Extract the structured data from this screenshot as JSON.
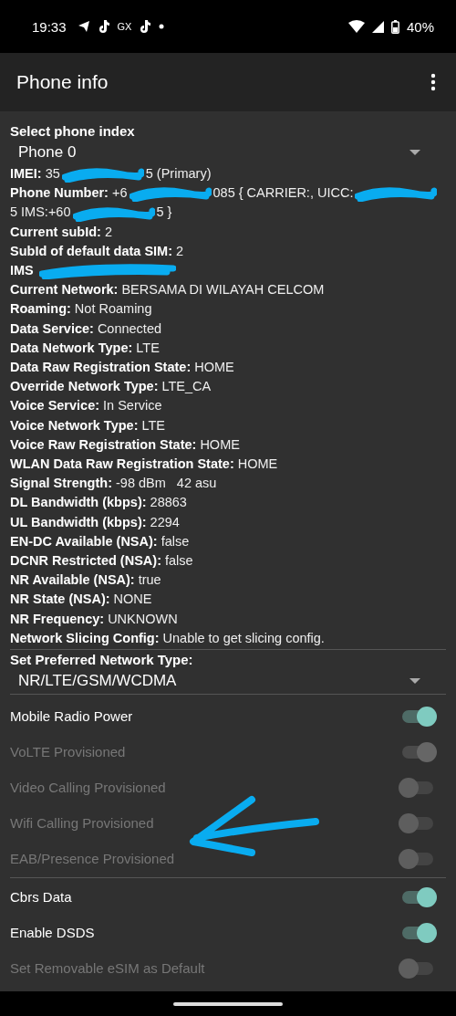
{
  "status_bar": {
    "time": "19:33",
    "notification_text": "GX",
    "battery": "40%"
  },
  "app_bar": {
    "title": "Phone info"
  },
  "phone_index": {
    "label": "Select phone index",
    "value": "Phone 0"
  },
  "info_rows": [
    {
      "label": "IMEI:",
      "parts": [
        "35",
        "5 (Primary)"
      ]
    },
    {
      "label": "Phone Number:",
      "parts": [
        "+6",
        "085 { CARRIER:, UICC:",
        "5 IMS:+60",
        "5 }"
      ]
    },
    {
      "label": "Current subId:",
      "value": "2"
    },
    {
      "label": "SubId of default data SIM:",
      "value": "2"
    },
    {
      "label": "IMS",
      "redacted": true
    },
    {
      "label": "Current Network:",
      "value": "BERSAMA DI WILAYAH CELCOM"
    },
    {
      "label": "Roaming:",
      "value": "Not Roaming"
    },
    {
      "label": "Data Service:",
      "value": "Connected"
    },
    {
      "label": "Data Network Type:",
      "value": "LTE"
    },
    {
      "label": "Data Raw Registration State:",
      "value": "HOME"
    },
    {
      "label": "Override Network Type:",
      "value": "LTE_CA"
    },
    {
      "label": "Voice Service:",
      "value": "In Service"
    },
    {
      "label": "Voice Network Type:",
      "value": "LTE"
    },
    {
      "label": "Voice Raw Registration State:",
      "value": "HOME"
    },
    {
      "label": "WLAN Data Raw Registration State:",
      "value": "HOME"
    },
    {
      "label": "Signal Strength:",
      "value": "-98 dBm   42 asu"
    },
    {
      "label": "DL Bandwidth (kbps):",
      "value": "28863"
    },
    {
      "label": "UL Bandwidth (kbps):",
      "value": "2294"
    },
    {
      "label": "EN-DC Available (NSA):",
      "value": "false"
    },
    {
      "label": "DCNR Restricted (NSA):",
      "value": "false"
    },
    {
      "label": "NR Available (NSA):",
      "value": "true"
    },
    {
      "label": "NR State (NSA):",
      "value": "NONE"
    },
    {
      "label": "NR Frequency:",
      "value": "UNKNOWN"
    },
    {
      "label": "Network Slicing Config:",
      "value": "Unable to get slicing config."
    }
  ],
  "network_type": {
    "label": "Set Preferred Network Type:",
    "value": "NR/LTE/GSM/WCDMA"
  },
  "toggle_groups": [
    [
      {
        "label": "Mobile Radio Power",
        "on": true,
        "disabled": false
      },
      {
        "label": "VoLTE Provisioned",
        "on": true,
        "disabled": true
      },
      {
        "label": "Video Calling Provisioned",
        "on": false,
        "disabled": true
      },
      {
        "label": "Wifi Calling Provisioned",
        "on": false,
        "disabled": true
      },
      {
        "label": "EAB/Presence Provisioned",
        "on": false,
        "disabled": true
      }
    ],
    [
      {
        "label": "Cbrs Data",
        "on": true,
        "disabled": false
      },
      {
        "label": "Enable DSDS",
        "on": true,
        "disabled": false
      },
      {
        "label": "Set Removable eSIM as Default",
        "on": false,
        "disabled": true
      }
    ]
  ]
}
